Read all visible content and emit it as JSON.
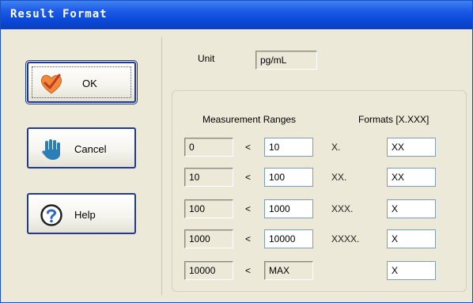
{
  "window": {
    "title": "Result Format"
  },
  "buttons": {
    "ok": "OK",
    "cancel": "Cancel",
    "help": "Help"
  },
  "unit": {
    "label": "Unit",
    "value": "pg/mL"
  },
  "headers": {
    "ranges": "Measurement Ranges",
    "formats": "Formats [X.XXX]"
  },
  "operator": "<",
  "rows": [
    {
      "low": "0",
      "high": "10",
      "format_label": "X.",
      "format_value": "XX"
    },
    {
      "low": "10",
      "high": "100",
      "format_label": "XX.",
      "format_value": "XX"
    },
    {
      "low": "100",
      "high": "1000",
      "format_label": "XXX.",
      "format_value": "X"
    },
    {
      "low": "1000",
      "high": "10000",
      "format_label": "XXXX.",
      "format_value": "X"
    },
    {
      "low": "10000",
      "high": "MAX",
      "format_label": "",
      "format_value": "X"
    }
  ],
  "icons": {
    "ok": "heart-check-icon",
    "cancel": "hand-stop-icon",
    "help": "question-icon"
  }
}
